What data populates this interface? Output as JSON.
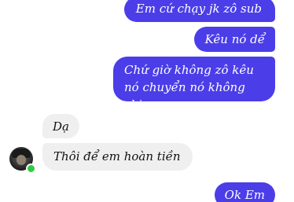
{
  "conversation": {
    "messages": [
      {
        "sender": "me",
        "text": "Em cứ chạy jk zô sub"
      },
      {
        "sender": "me",
        "text": "Kêu nó dể"
      },
      {
        "sender": "me",
        "text": "Chứ giờ không zô kêu nó chuyển nó không chịu"
      },
      {
        "sender": "other",
        "text": "Dạ"
      },
      {
        "sender": "other",
        "text": "Thôi để em hoàn tiền"
      },
      {
        "sender": "me",
        "text": "Ok Em"
      }
    ],
    "contact": {
      "status": "online",
      "status_color": "#2ecc40"
    },
    "colors": {
      "outgoing_bubble": "#4b3ee8",
      "incoming_bubble": "#efefef"
    }
  }
}
